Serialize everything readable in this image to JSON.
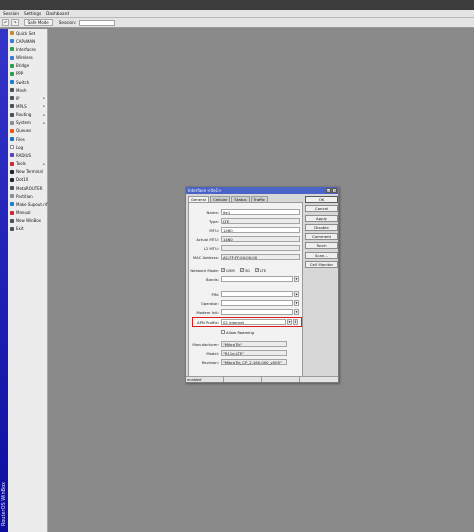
{
  "menu": [
    "Session",
    "Settings",
    "Dashboard"
  ],
  "toolbar": {
    "undo": "↶",
    "redo": "↷",
    "safe_mode": "Safe Mode",
    "session_label": "Session:"
  },
  "sidebar": {
    "brand": "RouterOS WinBox",
    "items": [
      {
        "label": "Quick Set",
        "icon": "quick-set-icon",
        "color": "#c58a2b",
        "arrow": ""
      },
      {
        "label": "CAPsMAN",
        "icon": "capsman-icon",
        "color": "#3a7bd5",
        "arrow": ""
      },
      {
        "label": "Interfaces",
        "icon": "interfaces-icon",
        "color": "#2f9e44",
        "arrow": ""
      },
      {
        "label": "Wireless",
        "icon": "wireless-icon",
        "color": "#3a7bd5",
        "arrow": ""
      },
      {
        "label": "Bridge",
        "icon": "bridge-icon",
        "color": "#2f9e44",
        "arrow": ""
      },
      {
        "label": "PPP",
        "icon": "ppp-icon",
        "color": "#2f9e44",
        "arrow": ""
      },
      {
        "label": "Switch",
        "icon": "switch-icon",
        "color": "#1c7ed6",
        "arrow": ""
      },
      {
        "label": "Mesh",
        "icon": "mesh-icon",
        "color": "#495057",
        "arrow": ""
      },
      {
        "label": "IP",
        "icon": "ip-icon",
        "color": "#495057",
        "arrow": "▸"
      },
      {
        "label": "MPLS",
        "icon": "mpls-icon",
        "color": "#495057",
        "arrow": "▸"
      },
      {
        "label": "Routing",
        "icon": "routing-icon",
        "color": "#495057",
        "arrow": "▸"
      },
      {
        "label": "System",
        "icon": "system-icon",
        "color": "#868e96",
        "arrow": "▸"
      },
      {
        "label": "Queues",
        "icon": "queues-icon",
        "color": "#e8590c",
        "arrow": ""
      },
      {
        "label": "Files",
        "icon": "files-icon",
        "color": "#1971c2",
        "arrow": ""
      },
      {
        "label": "Log",
        "icon": "log-icon",
        "color": "#ffffff",
        "arrow": ""
      },
      {
        "label": "RADIUS",
        "icon": "radius-icon",
        "color": "#5f3dc4",
        "arrow": ""
      },
      {
        "label": "Tools",
        "icon": "tools-icon",
        "color": "#c92a2a",
        "arrow": "▸"
      },
      {
        "label": "New Terminal",
        "icon": "terminal-icon",
        "color": "#212529",
        "arrow": ""
      },
      {
        "label": "Dot1X",
        "icon": "dot1x-icon",
        "color": "#212529",
        "arrow": ""
      },
      {
        "label": "MetaROUTER",
        "icon": "metarouter-icon",
        "color": "#495057",
        "arrow": ""
      },
      {
        "label": "Partition",
        "icon": "partition-icon",
        "color": "#868e96",
        "arrow": ""
      },
      {
        "label": "Make Supout.rif",
        "icon": "supout-icon",
        "color": "#1c7ed6",
        "arrow": ""
      },
      {
        "label": "Manual",
        "icon": "manual-icon",
        "color": "#c92a2a",
        "arrow": ""
      },
      {
        "label": "New WinBox",
        "icon": "winbox-icon",
        "color": "#495057",
        "arrow": ""
      },
      {
        "label": "Exit",
        "icon": "exit-icon",
        "color": "#495057",
        "arrow": ""
      }
    ]
  },
  "window": {
    "title": "Interface <lte1>",
    "tabs": [
      "General",
      "Cellular",
      "Status",
      "Traffic"
    ],
    "fields": {
      "name": {
        "label": "Name:",
        "value": "lte1"
      },
      "type": {
        "label": "Type:",
        "value": "LTE"
      },
      "mtu": {
        "label": "MTU:",
        "value": "1460"
      },
      "actual_mtu": {
        "label": "Actual MTU:",
        "value": "1460"
      },
      "l2_mtu": {
        "label": "L2 MTU:",
        "value": ""
      },
      "mac": {
        "label": "MAC Address:",
        "value": "AC:FF:FF:00:00:00"
      },
      "network_mode": {
        "label": "Network Mode:",
        "options": [
          "GSM",
          "3G",
          "LTE"
        ]
      },
      "bands": {
        "label": "Bands:",
        "value": ""
      },
      "pin": {
        "label": "PIN:",
        "value": ""
      },
      "operator": {
        "label": "Operator:",
        "value": ""
      },
      "modem_init": {
        "label": "Modem Init:",
        "value": ""
      },
      "apn_profile": {
        "label": "APN Profile:",
        "value": "02 internet"
      },
      "allow_roaming": {
        "label": "Allow Roaming"
      },
      "manufacturer": {
        "label": "Manufacturer:",
        "value": "\"MikroTik\""
      },
      "model": {
        "label": "Model:",
        "value": "\"R11e-LTE\""
      },
      "revision": {
        "label": "Revision:",
        "value": "\"MikroTik_CP_2.160.000_v005\""
      }
    },
    "buttons": [
      "OK",
      "Cancel",
      "Apply",
      "Disable",
      "Comment",
      "Torch",
      "Scan...",
      "Cell Monitor"
    ],
    "status": [
      "enabled",
      "",
      "",
      ""
    ]
  },
  "colors": {
    "title_bar": "#4a63c6",
    "highlight": "#e01b1b",
    "brand_strip": "#1a1ab0"
  }
}
